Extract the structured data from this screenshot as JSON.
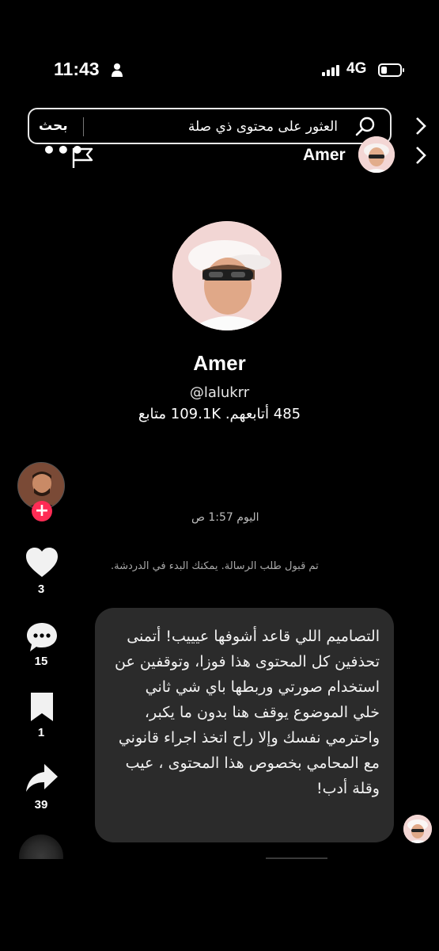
{
  "status_bar": {
    "time": "11:43",
    "network": "4G"
  },
  "search": {
    "placeholder": "العثور على محتوى ذي صلة",
    "button": "بحث"
  },
  "header": {
    "more": "•••",
    "name": "Amer"
  },
  "profile": {
    "name": "Amer",
    "handle": "@lalukrr",
    "stats": "485 أتابعهم. 109.1K متابع"
  },
  "chat": {
    "date": "اليوم 1:57 ص",
    "accepted_notice": "تم قبول طلب الرسالة. يمكنك البدء في الدردشة.",
    "message": "التصاميم اللي قاعد أشوفها عيييب! أتمنى تحذفين كل المحتوى هذا فوزا، وتوقفين عن استخدام صورتي وربطها باي شي ثاني\nخلي الموضوع يوقف هنا بدون ما يكبر، واحترمي نفسك وإلا راح اتخذ اجراء قانوني مع المحامي بخصوص هذا المحتوى ، عيب وقلة أدب!"
  },
  "sidebar": {
    "follow_plus": "+",
    "likes": "3",
    "comments": "15",
    "saves": "1",
    "shares": "39"
  },
  "colors": {
    "background": "#000000",
    "bubble": "#2b2b2b",
    "accent": "#fe2c55"
  },
  "icons": [
    "person-icon",
    "signal-icon",
    "battery-icon",
    "search-icon",
    "chevron-right-icon",
    "flag-icon",
    "heart-icon",
    "comment-icon",
    "bookmark-icon",
    "share-icon"
  ]
}
